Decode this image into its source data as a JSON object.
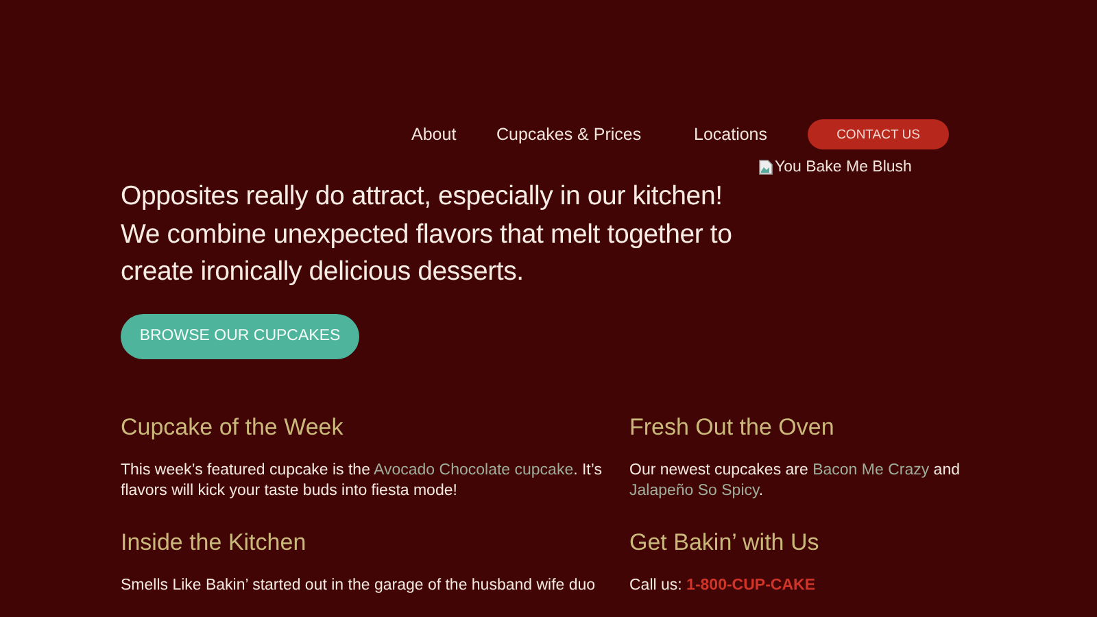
{
  "nav": {
    "links": [
      {
        "label": "About"
      },
      {
        "label": "Cupcakes & Prices"
      },
      {
        "label": "Locations"
      }
    ],
    "contact_button": "CONTACT US"
  },
  "logo": {
    "alt": "You Bake Me Blush"
  },
  "hero": {
    "text": "Opposites really do attract, especially in our kitchen! We combine unexpected flavors that melt together to create ironically delicious desserts.",
    "button": "BROWSE OUR CUPCAKES"
  },
  "sections": [
    {
      "title": "Cupcake of the Week",
      "paragraph": [
        {
          "kind": "text",
          "text": "This week’s featured cupcake is the "
        },
        {
          "kind": "link",
          "text": "Avocado Chocolate cupcake"
        },
        {
          "kind": "text",
          "text": ". It’s flavors will kick your taste buds into fiesta mode!"
        }
      ]
    },
    {
      "title": "Fresh Out the Oven",
      "paragraph": [
        {
          "kind": "text",
          "text": "Our newest cupcakes are "
        },
        {
          "kind": "link",
          "text": "Bacon Me Crazy"
        },
        {
          "kind": "text",
          "text": " and"
        },
        {
          "kind": "break"
        },
        {
          "kind": "link",
          "text": "Jalapeño So Spicy"
        },
        {
          "kind": "text",
          "text": "."
        }
      ]
    },
    {
      "title": "Inside the Kitchen",
      "paragraph": [
        {
          "kind": "text",
          "text": "Smells Like Bakin’ started out in the garage of the husband wife duo"
        }
      ]
    },
    {
      "title": "Get Bakin’ with Us",
      "paragraph": [
        {
          "kind": "text",
          "text": "Call us: "
        },
        {
          "kind": "phone",
          "text": "1-800-CUP-CAKE"
        }
      ]
    }
  ]
}
